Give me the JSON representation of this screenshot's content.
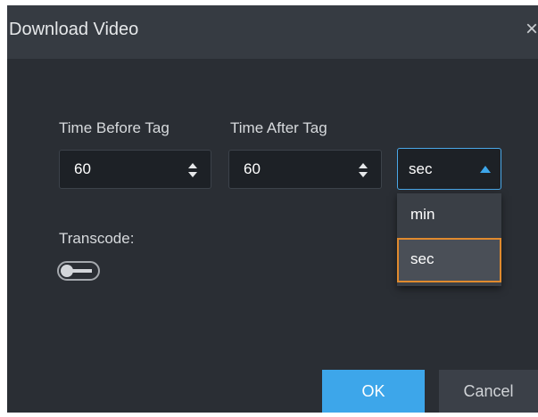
{
  "dialog": {
    "title": "Download Video",
    "close_glyph": "×"
  },
  "form": {
    "time_before": {
      "label": "Time Before Tag",
      "value": "60"
    },
    "time_after": {
      "label": "Time After Tag",
      "value": "60"
    },
    "unit": {
      "selected": "sec",
      "options": [
        "min",
        "sec"
      ],
      "highlighted_option": "sec"
    },
    "transcode": {
      "label": "Transcode:",
      "enabled": false
    }
  },
  "buttons": {
    "ok_label": "OK",
    "cancel_label": "Cancel"
  },
  "colors": {
    "dialog_bg": "#2a2e34",
    "titlebar_bg": "#363b42",
    "accent": "#3da6ea",
    "highlight": "#e08a2e"
  },
  "icons": [
    "close-icon",
    "stepper-arrows-icon",
    "caret-up-icon",
    "toggle-switch"
  ]
}
